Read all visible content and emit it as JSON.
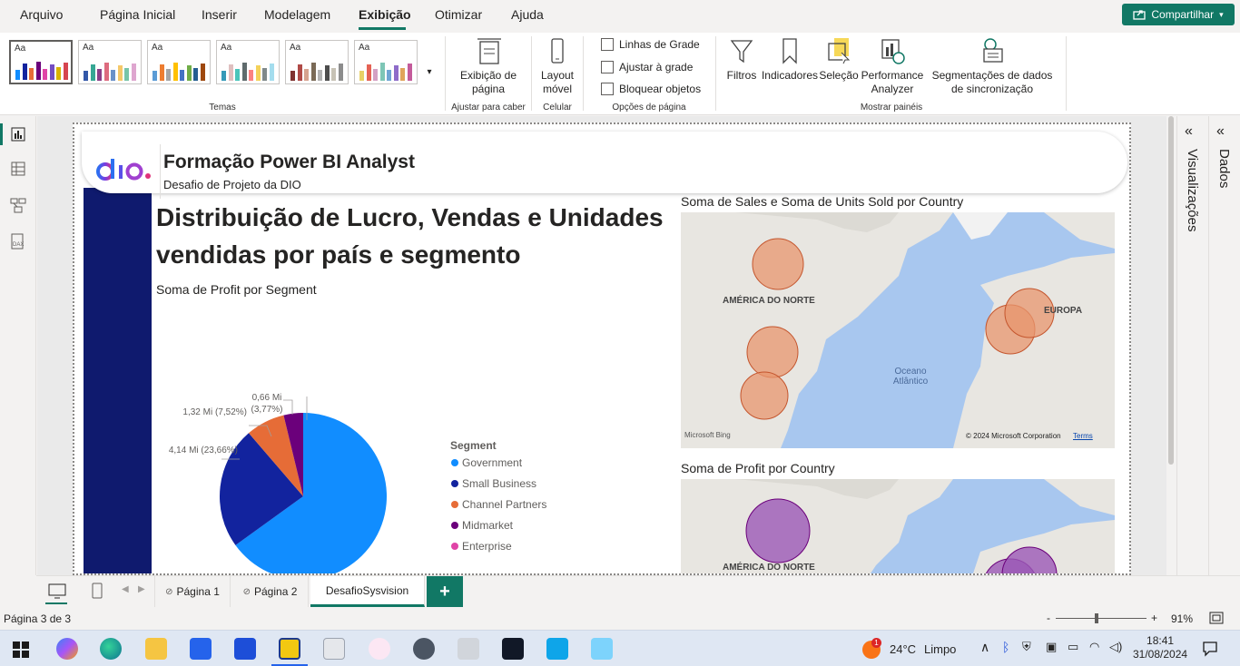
{
  "menu": {
    "items": [
      "Arquivo",
      "Página Inicial",
      "Inserir",
      "Modelagem",
      "Exibição",
      "Otimizar",
      "Ajuda"
    ],
    "active_index": 4,
    "share_label": "Compartilhar"
  },
  "ribbon": {
    "themes_label": "Temas",
    "theme_glyph": "Aa",
    "page_view_label": "Exibição de página",
    "fit_group_label": "Ajustar para caber",
    "mobile_layout_label": "Layout móvel",
    "mobile_group_label": "Celular",
    "checkboxes": [
      "Linhas de Grade",
      "Ajustar à grade",
      "Bloquear objetos"
    ],
    "page_options_label": "Opções de página",
    "panes": [
      "Filtros",
      "Indicadores",
      "Seleção",
      "Performance Analyzer",
      "Segmentações de dados de sincronização"
    ],
    "panes_group_label": "Mostrar painéis"
  },
  "report": {
    "logo_text": "dio.",
    "header_title": "Formação Power BI Analyst",
    "header_subtitle": "Desafio de Projeto da DIO",
    "main_title": "Distribuição de Lucro, Vendas e Unidades vendidas por país e segmento",
    "pie_title": "Soma de Profit por Segment",
    "map1_title": "Soma de Sales e Soma de Units Sold por Country",
    "map2_title": "Soma de Profit por Country",
    "map_labels": {
      "north_america": "AMÉRICA DO NORTE",
      "europe": "EUROPA",
      "ocean": "Oceano Atlântico",
      "bing": "Microsoft Bing",
      "copyright": "© 2024 Microsoft Corporation",
      "terms": "Terms"
    },
    "legend_title": "Segment",
    "legend": [
      {
        "name": "Government",
        "color": "#118dff"
      },
      {
        "name": "Small Business",
        "color": "#12239e"
      },
      {
        "name": "Channel Partners",
        "color": "#e66c37"
      },
      {
        "name": "Midmarket",
        "color": "#6b007b"
      },
      {
        "name": "Enterprise",
        "color": "#e044a7"
      }
    ],
    "pie_labels": {
      "small_business": "4,14 Mi (23,66%)",
      "channel_partners": "1,32 Mi (7,52%)",
      "midmarket": "0,66 Mi (3,77%)"
    }
  },
  "chart_data": {
    "type": "pie",
    "title": "Soma de Profit por Segment",
    "categories": [
      "Government",
      "Small Business",
      "Channel Partners",
      "Midmarket",
      "Enterprise"
    ],
    "values": [
      11.39,
      4.14,
      1.32,
      0.66,
      0
    ],
    "percents": [
      65.05,
      23.66,
      7.52,
      3.77,
      0
    ],
    "colors": [
      "#118dff",
      "#12239e",
      "#e66c37",
      "#6b007b",
      "#e044a7"
    ],
    "unit": "Mi"
  },
  "pages": {
    "tabs": [
      "Página 1",
      "Página 2",
      "DesafioSysvision"
    ],
    "active_index": 2,
    "add_label": "+"
  },
  "status": {
    "page_info": "Página 3 de 3",
    "zoom": "91%",
    "zoom_minus": "-",
    "zoom_plus": "+"
  },
  "right_panes": {
    "visualizations": "Visualizações",
    "data": "Dados"
  },
  "taskbar": {
    "weather_temp": "24°C",
    "weather_text": "Limpo",
    "weather_badge": "1",
    "time": "18:41",
    "date": "31/08/2024"
  }
}
